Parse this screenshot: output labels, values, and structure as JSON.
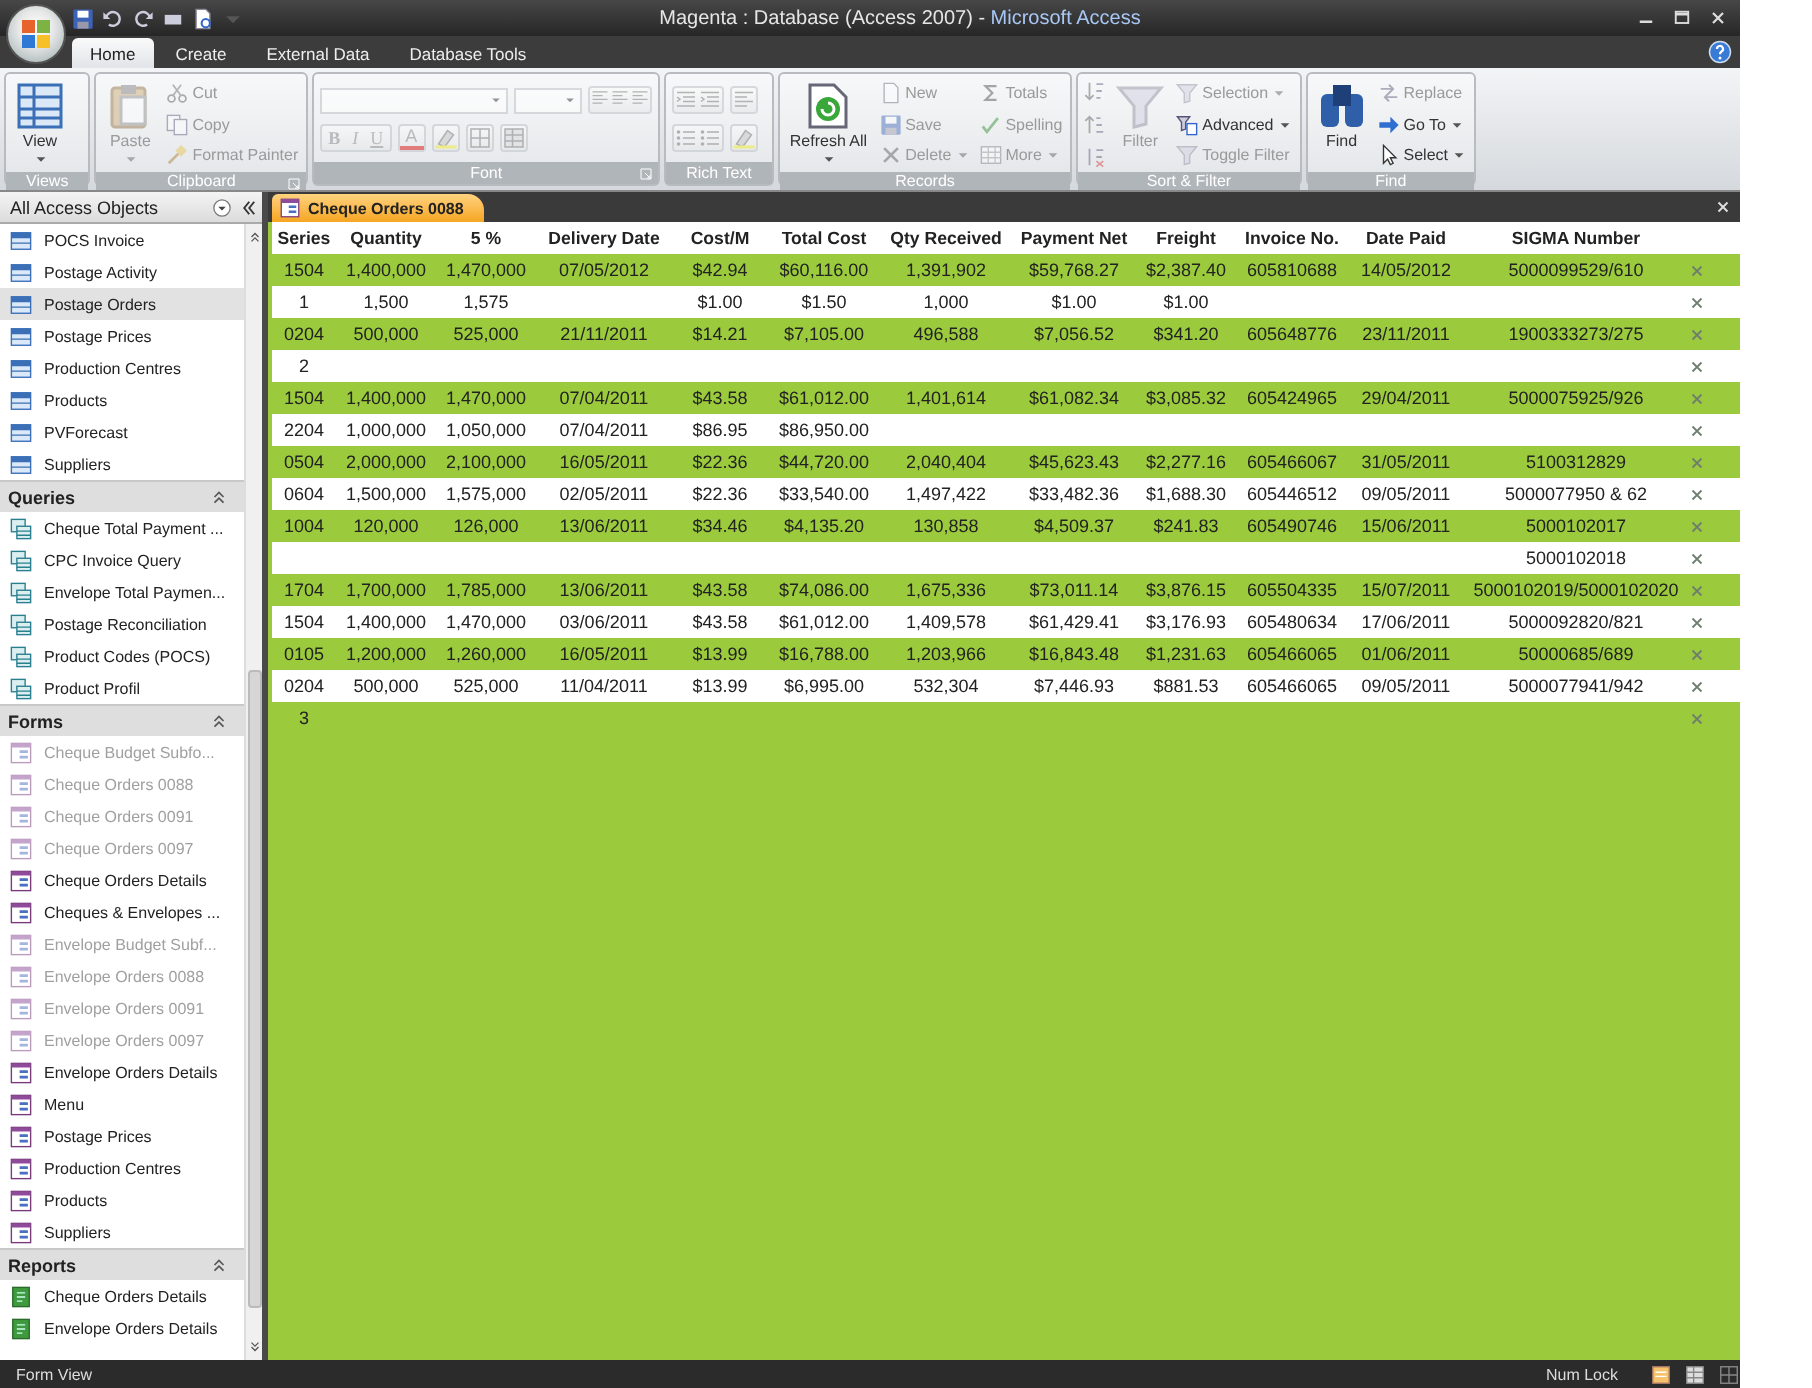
{
  "window": {
    "title": "Magenta : Database (Access 2007) -",
    "app_name": "Microsoft Access"
  },
  "ribbon_tabs": [
    {
      "label": "Home",
      "selected": true
    },
    {
      "label": "Create",
      "selected": false
    },
    {
      "label": "External Data",
      "selected": false
    },
    {
      "label": "Database Tools",
      "selected": false
    }
  ],
  "ribbon_groups": [
    {
      "title": "Views",
      "launcher": false,
      "items": [
        {
          "label": "View",
          "kind": "large",
          "disabled": false,
          "caret": true
        }
      ]
    },
    {
      "title": "Clipboard",
      "launcher": true,
      "items": [
        {
          "label": "Paste",
          "kind": "large",
          "disabled": true,
          "caret": true
        },
        {
          "label": "Cut",
          "kind": "small",
          "disabled": true,
          "caret": false
        },
        {
          "label": "Copy",
          "kind": "small",
          "disabled": true,
          "caret": false
        },
        {
          "label": "Format Painter",
          "kind": "small",
          "disabled": true,
          "caret": false
        }
      ]
    },
    {
      "title": "Font",
      "launcher": true,
      "items": [
        {
          "kind": "font-panel",
          "disabled": true,
          "labels": [
            "B",
            "I",
            "U",
            "A"
          ]
        }
      ]
    },
    {
      "title": "Rich Text",
      "launcher": false,
      "items": [
        {
          "kind": "icon-panel",
          "disabled": true
        }
      ]
    },
    {
      "title": "Records",
      "launcher": false,
      "items": [
        {
          "label": "Refresh All",
          "kind": "large",
          "disabled": false,
          "caret": true
        },
        {
          "label": "New",
          "kind": "small",
          "disabled": true,
          "caret": false
        },
        {
          "label": "Save",
          "kind": "small",
          "disabled": true,
          "caret": false
        },
        {
          "label": "Delete",
          "kind": "small",
          "disabled": true,
          "caret": true
        },
        {
          "label": "Totals",
          "kind": "small",
          "disabled": true,
          "caret": false
        },
        {
          "label": "Spelling",
          "kind": "small",
          "disabled": true,
          "caret": false
        },
        {
          "label": "More",
          "kind": "small",
          "disabled": true,
          "caret": true
        }
      ]
    },
    {
      "title": "Sort & Filter",
      "launcher": false,
      "items": [
        {
          "kind": "sort-panel",
          "disabled": true
        },
        {
          "label": "Filter",
          "kind": "large",
          "disabled": true,
          "caret": false
        },
        {
          "label": "Selection",
          "kind": "small",
          "disabled": true,
          "caret": true
        },
        {
          "label": "Advanced",
          "kind": "small",
          "disabled": false,
          "caret": true
        },
        {
          "label": "Toggle Filter",
          "kind": "small",
          "disabled": true,
          "caret": false
        }
      ]
    },
    {
      "title": "Find",
      "launcher": false,
      "items": [
        {
          "label": "Find",
          "kind": "large",
          "disabled": false,
          "caret": false
        },
        {
          "label": "Replace",
          "kind": "small",
          "disabled": true,
          "caret": false
        },
        {
          "label": "Go To",
          "kind": "small",
          "disabled": false,
          "caret": true
        },
        {
          "label": "Select",
          "kind": "small",
          "disabled": false,
          "caret": true
        }
      ]
    }
  ],
  "nav": {
    "title": "All Access Objects",
    "sections": [
      {
        "kind": "table",
        "items": [
          {
            "label": "POCS Invoice",
            "selected": false,
            "disabled": false
          },
          {
            "label": "Postage Activity",
            "selected": false,
            "disabled": false
          },
          {
            "label": "Postage Orders",
            "selected": true,
            "disabled": false
          },
          {
            "label": "Postage Prices",
            "selected": false,
            "disabled": false
          },
          {
            "label": "Production Centres",
            "selected": false,
            "disabled": false
          },
          {
            "label": "Products",
            "selected": false,
            "disabled": false
          },
          {
            "label": "PVForecast",
            "selected": false,
            "disabled": false
          },
          {
            "label": "Suppliers",
            "selected": false,
            "disabled": false
          }
        ]
      },
      {
        "kind": "query",
        "title": "Queries",
        "expanded": true,
        "items": [
          {
            "label": "Cheque Total Payment ...",
            "selected": false,
            "disabled": false
          },
          {
            "label": "CPC Invoice Query",
            "selected": false,
            "disabled": false
          },
          {
            "label": "Envelope Total Paymen...",
            "selected": false,
            "disabled": false
          },
          {
            "label": "Postage Reconciliation",
            "selected": false,
            "disabled": false
          },
          {
            "label": "Product Codes (POCS)",
            "selected": false,
            "disabled": false
          },
          {
            "label": "Product Profil",
            "selected": false,
            "disabled": false
          }
        ]
      },
      {
        "kind": "form",
        "title": "Forms",
        "expanded": true,
        "items": [
          {
            "label": "Cheque Budget Subfo...",
            "selected": false,
            "disabled": true
          },
          {
            "label": "Cheque Orders 0088",
            "selected": false,
            "disabled": true
          },
          {
            "label": "Cheque Orders 0091",
            "selected": false,
            "disabled": true
          },
          {
            "label": "Cheque Orders 0097",
            "selected": false,
            "disabled": true
          },
          {
            "label": "Cheque Orders Details",
            "selected": false,
            "disabled": false
          },
          {
            "label": "Cheques & Envelopes ...",
            "selected": false,
            "disabled": false
          },
          {
            "label": "Envelope Budget Subf...",
            "selected": false,
            "disabled": true
          },
          {
            "label": "Envelope Orders 0088",
            "selected": false,
            "disabled": true
          },
          {
            "label": "Envelope Orders 0091",
            "selected": false,
            "disabled": true
          },
          {
            "label": "Envelope Orders 0097",
            "selected": false,
            "disabled": true
          },
          {
            "label": "Envelope Orders Details",
            "selected": false,
            "disabled": false
          },
          {
            "label": "Menu",
            "selected": false,
            "disabled": false
          },
          {
            "label": "Postage Prices",
            "selected": false,
            "disabled": false
          },
          {
            "label": "Production Centres",
            "selected": false,
            "disabled": false
          },
          {
            "label": "Products",
            "selected": false,
            "disabled": false
          },
          {
            "label": "Suppliers",
            "selected": false,
            "disabled": false
          }
        ]
      },
      {
        "kind": "report",
        "title": "Reports",
        "expanded": true,
        "items": [
          {
            "label": "Cheque Orders Details",
            "selected": false,
            "disabled": false
          },
          {
            "label": "Envelope Orders Details",
            "selected": false,
            "disabled": false
          }
        ]
      }
    ]
  },
  "document_tab": {
    "label": "Cheque Orders 0088",
    "selected": true
  },
  "table": {
    "columns": [
      "Series",
      "Quantity",
      "5 %",
      "Delivery Date",
      "Cost/M",
      "Total Cost",
      "Qty Received",
      "Payment Net",
      "Freight",
      "Invoice No.",
      "Date Paid",
      "SIGMA Number"
    ],
    "rows": [
      [
        "1504",
        "1,400,000",
        "1,470,000",
        "07/05/2012",
        "$42.94",
        "$60,116.00",
        "1,391,902",
        "$59,768.27",
        "$2,387.40",
        "605810688",
        "14/05/2012",
        "5000099529/610"
      ],
      [
        "1",
        "1,500",
        "1,575",
        null,
        "$1.00",
        "$1.50",
        "1,000",
        "$1.00",
        "$1.00",
        null,
        null,
        null
      ],
      [
        "0204",
        "500,000",
        "525,000",
        "21/11/2011",
        "$14.21",
        "$7,105.00",
        "496,588",
        "$7,056.52",
        "$341.20",
        "605648776",
        "23/11/2011",
        "1900333273/275"
      ],
      [
        "2",
        null,
        null,
        null,
        null,
        null,
        null,
        null,
        null,
        null,
        null,
        null
      ],
      [
        "1504",
        "1,400,000",
        "1,470,000",
        "07/04/2011",
        "$43.58",
        "$61,012.00",
        "1,401,614",
        "$61,082.34",
        "$3,085.32",
        "605424965",
        "29/04/2011",
        "5000075925/926"
      ],
      [
        "2204",
        "1,000,000",
        "1,050,000",
        "07/04/2011",
        "$86.95",
        "$86,950.00",
        null,
        null,
        null,
        null,
        null,
        null
      ],
      [
        "0504",
        "2,000,000",
        "2,100,000",
        "16/05/2011",
        "$22.36",
        "$44,720.00",
        "2,040,404",
        "$45,623.43",
        "$2,277.16",
        "605466067",
        "31/05/2011",
        "5100312829"
      ],
      [
        "0604",
        "1,500,000",
        "1,575,000",
        "02/05/2011",
        "$22.36",
        "$33,540.00",
        "1,497,422",
        "$33,482.36",
        "$1,688.30",
        "605446512",
        "09/05/2011",
        "5000077950 & 62"
      ],
      [
        "1004",
        "120,000",
        "126,000",
        "13/06/2011",
        "$34.46",
        "$4,135.20",
        "130,858",
        "$4,509.37",
        "$241.83",
        "605490746",
        "15/06/2011",
        "5000102017"
      ],
      [
        null,
        null,
        null,
        null,
        null,
        null,
        null,
        null,
        null,
        null,
        null,
        "5000102018"
      ],
      [
        "1704",
        "1,700,000",
        "1,785,000",
        "13/06/2011",
        "$43.58",
        "$74,086.00",
        "1,675,336",
        "$73,011.14",
        "$3,876.15",
        "605504335",
        "15/07/2011",
        "5000102019/5000102020"
      ],
      [
        "1504",
        "1,400,000",
        "1,470,000",
        "03/06/2011",
        "$43.58",
        "$61,012.00",
        "1,409,578",
        "$61,429.41",
        "$3,176.93",
        "605480634",
        "17/06/2011",
        "5000092820/821"
      ],
      [
        "0105",
        "1,200,000",
        "1,260,000",
        "16/05/2011",
        "$13.99",
        "$16,788.00",
        "1,203,966",
        "$16,843.48",
        "$1,231.63",
        "605466065",
        "01/06/2011",
        "50000685/689"
      ],
      [
        "0204",
        "500,000",
        "525,000",
        "11/04/2011",
        "$13.99",
        "$6,995.00",
        "532,304",
        "$7,446.93",
        "$881.53",
        "605466065",
        "09/05/2011",
        "5000077941/942"
      ],
      [
        "3",
        null,
        null,
        null,
        null,
        null,
        null,
        null,
        null,
        null,
        null,
        null
      ]
    ]
  },
  "status_bar": {
    "text": "Form View",
    "indicators": [
      "Num Lock"
    ]
  }
}
